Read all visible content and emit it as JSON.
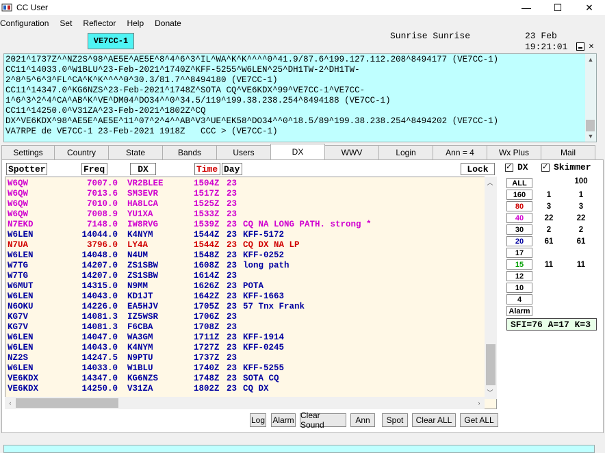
{
  "window": {
    "title": "CC User",
    "minimize": "—",
    "maximize": "☐",
    "close": "✕"
  },
  "menu": [
    "Configuration",
    "Set",
    "Reflector",
    "Help",
    "Donate"
  ],
  "header": {
    "callsign": "VE7CC-1",
    "sunrise": "Sunrise Sunrise",
    "date": "23 Feb",
    "time": "19:21:01"
  },
  "console_lines": [
    "2021^1737Z^^NZ2S^98^AE5E^AE5E^8^4^6^3^IL^WA^K^K^^^^0^41.9/87.6^199.127.112.208^8494177 (VE7CC-1)",
    "CC11^14033.0^W1BLU^23-Feb-2021^1740Z^KFF-5255^W6LEN^25^DH1TW-2^DH1TW-",
    "2^8^5^6^3^FL^CA^K^K^^^^0^30.3/81.7^^8494180 (VE7CC-1)",
    "CC11^14347.0^KG6NZS^23-Feb-2021^1748Z^SOTA CQ^VE6KDX^99^VE7CC-1^VE7CC-",
    "1^6^3^2^4^CA^AB^K^VE^DM04^DO34^^0^34.5/119^199.38.238.254^8494188 (VE7CC-1)",
    "CC11^14250.0^V31ZA^23-Feb-2021^1802Z^CQ",
    "DX^VE6KDX^98^AE5E^AE5E^11^07^2^4^^AB^V3^UE^EK58^DO34^^0^18.5/89^199.38.238.254^8494202 (VE7CC-1)",
    "VA7RPE de VE7CC-1 23-Feb-2021 1918Z   CCC > (VE7CC-1)"
  ],
  "tabs": [
    {
      "label": "Settings"
    },
    {
      "label": "Country"
    },
    {
      "label": "State"
    },
    {
      "label": "Bands"
    },
    {
      "label": "Users"
    },
    {
      "label": "DX"
    },
    {
      "label": "WWV"
    },
    {
      "label": "Login"
    },
    {
      "label": "Ann = 4"
    },
    {
      "label": "Wx Plus"
    },
    {
      "label": "Mail"
    }
  ],
  "columns": {
    "spotter": "Spotter",
    "freq": "Freq",
    "dx": "DX",
    "time": "Time",
    "day": "Day",
    "lock": "Lock"
  },
  "colors": {
    "magenta": "#d000d0",
    "red": "#d00000",
    "blue": "#0000a0",
    "cyan": "#bfffff"
  },
  "spots": [
    {
      "spotter": "W6QW",
      "freq": "7007.0",
      "dx": "VR2BLEE",
      "time": "1504Z",
      "day": "23",
      "comment": "",
      "color": "magenta"
    },
    {
      "spotter": "W6QW",
      "freq": "7013.6",
      "dx": "SM3EVR",
      "time": "1517Z",
      "day": "23",
      "comment": "",
      "color": "magenta"
    },
    {
      "spotter": "W6QW",
      "freq": "7010.0",
      "dx": "HA8LCA",
      "time": "1525Z",
      "day": "23",
      "comment": "",
      "color": "magenta"
    },
    {
      "spotter": "W6QW",
      "freq": "7008.9",
      "dx": "YU1XA",
      "time": "1533Z",
      "day": "23",
      "comment": "",
      "color": "magenta"
    },
    {
      "spotter": "N7EKD",
      "freq": "7148.0",
      "dx": "IW8RVG",
      "time": "1539Z",
      "day": "23",
      "comment": "CQ NA LONG PATH. strong *",
      "color": "magenta"
    },
    {
      "spotter": "W6LEN",
      "freq": "14044.0",
      "dx": "K4NYM",
      "time": "1544Z",
      "day": "23",
      "comment": "KFF-5172",
      "color": "blue"
    },
    {
      "spotter": "N7UA",
      "freq": "3796.0",
      "dx": "LY4A",
      "time": "1544Z",
      "day": "23",
      "comment": "CQ DX NA LP",
      "color": "red"
    },
    {
      "spotter": "W6LEN",
      "freq": "14048.0",
      "dx": "N4UM",
      "time": "1548Z",
      "day": "23",
      "comment": "KFF-0252",
      "color": "blue"
    },
    {
      "spotter": "W7TG",
      "freq": "14207.0",
      "dx": "ZS1SBW",
      "time": "1608Z",
      "day": "23",
      "comment": "long path",
      "color": "blue"
    },
    {
      "spotter": "W7TG",
      "freq": "14207.0",
      "dx": "ZS1SBW",
      "time": "1614Z",
      "day": "23",
      "comment": "",
      "color": "blue"
    },
    {
      "spotter": "W6MUT",
      "freq": "14315.0",
      "dx": "N9MM",
      "time": "1626Z",
      "day": "23",
      "comment": "POTA",
      "color": "blue"
    },
    {
      "spotter": "W6LEN",
      "freq": "14043.0",
      "dx": "KD1JT",
      "time": "1642Z",
      "day": "23",
      "comment": "KFF-1663",
      "color": "blue"
    },
    {
      "spotter": "N6OKU",
      "freq": "14226.0",
      "dx": "EA5HJV",
      "time": "1705Z",
      "day": "23",
      "comment": "57 Tnx Frank",
      "color": "blue"
    },
    {
      "spotter": "KG7V",
      "freq": "14081.3",
      "dx": "IZ5WSR",
      "time": "1706Z",
      "day": "23",
      "comment": "",
      "color": "blue"
    },
    {
      "spotter": "KG7V",
      "freq": "14081.3",
      "dx": "F6CBA",
      "time": "1708Z",
      "day": "23",
      "comment": "",
      "color": "blue"
    },
    {
      "spotter": "W6LEN",
      "freq": "14047.0",
      "dx": "WA3GM",
      "time": "1711Z",
      "day": "23",
      "comment": "KFF-1914",
      "color": "blue"
    },
    {
      "spotter": "W6LEN",
      "freq": "14043.0",
      "dx": "K4NYM",
      "time": "1727Z",
      "day": "23",
      "comment": "KFF-0245",
      "color": "blue"
    },
    {
      "spotter": "NZ2S",
      "freq": "14247.5",
      "dx": "N9PTU",
      "time": "1737Z",
      "day": "23",
      "comment": "",
      "color": "blue"
    },
    {
      "spotter": "W6LEN",
      "freq": "14033.0",
      "dx": "W1BLU",
      "time": "1740Z",
      "day": "23",
      "comment": "KFF-5255",
      "color": "blue"
    },
    {
      "spotter": "VE6KDX",
      "freq": "14347.0",
      "dx": "KG6NZS",
      "time": "1748Z",
      "day": "23",
      "comment": "SOTA CQ",
      "color": "blue"
    },
    {
      "spotter": "VE6KDX",
      "freq": "14250.0",
      "dx": "V31ZA",
      "time": "1802Z",
      "day": "23",
      "comment": "CQ DX",
      "color": "blue"
    }
  ],
  "filters": {
    "dx_label": "DX",
    "skimmer_label": "Skimmer"
  },
  "bands": [
    {
      "label": "ALL",
      "color": "#000000",
      "dx": "",
      "skimmer": "100"
    },
    {
      "label": "160",
      "color": "#000000",
      "dx": "1",
      "skimmer": "1"
    },
    {
      "label": "80",
      "color": "#d00000",
      "dx": "3",
      "skimmer": "3"
    },
    {
      "label": "40",
      "color": "#d000d0",
      "dx": "22",
      "skimmer": "22"
    },
    {
      "label": "30",
      "color": "#000000",
      "dx": "2",
      "skimmer": "2"
    },
    {
      "label": "20",
      "color": "#0000a0",
      "dx": "61",
      "skimmer": "61"
    },
    {
      "label": "17",
      "color": "#000000",
      "dx": "",
      "skimmer": ""
    },
    {
      "label": "15",
      "color": "#00a000",
      "dx": "11",
      "skimmer": "11"
    },
    {
      "label": "12",
      "color": "#000000",
      "dx": "",
      "skimmer": ""
    },
    {
      "label": "10",
      "color": "#000000",
      "dx": "",
      "skimmer": ""
    },
    {
      "label": "4",
      "color": "#000000",
      "dx": "",
      "skimmer": ""
    },
    {
      "label": "Alarm",
      "color": "#000000",
      "dx": "",
      "skimmer": ""
    }
  ],
  "solar": "SFI=76 A=17 K=3",
  "buttons": [
    "Log",
    "Alarm",
    "Clear Sound",
    "Ann",
    "Spot",
    "Clear ALL",
    "Get ALL"
  ]
}
